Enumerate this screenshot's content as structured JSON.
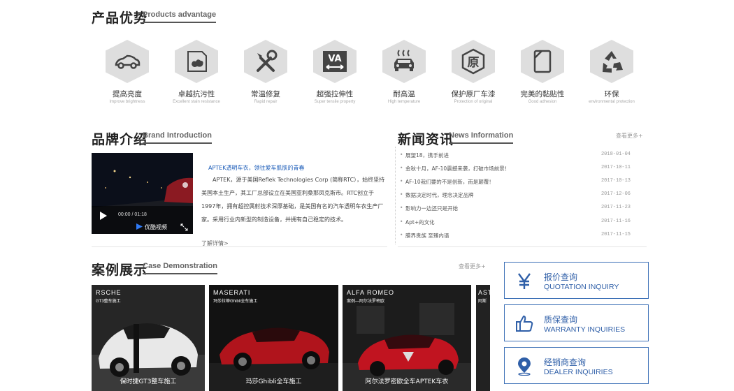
{
  "advantage": {
    "title": "产品优势",
    "subtitle": "Products advantage",
    "items": [
      {
        "label": "提高亮度",
        "en": "Improve brightness",
        "icon": "car-icon"
      },
      {
        "label": "卓越抗污性",
        "en": "Excellent stain resistance",
        "icon": "stain-icon"
      },
      {
        "label": "常温修复",
        "en": "Rapid repair",
        "icon": "tools-icon"
      },
      {
        "label": "超强拉伸性",
        "en": "Super tensile property",
        "icon": "va-stretch-icon"
      },
      {
        "label": "耐高温",
        "en": "High temperature",
        "icon": "hot-car-icon"
      },
      {
        "label": "保护原厂车漆",
        "en": "Protection of original",
        "icon": "original-seal-icon"
      },
      {
        "label": "完美的黏贴性",
        "en": "Good adhesion",
        "icon": "adhesion-icon"
      },
      {
        "label": "环保",
        "en": "environmental protection",
        "icon": "recycle-icon"
      }
    ]
  },
  "brand": {
    "title": "品牌介绍",
    "subtitle": "Brand Introduction",
    "headline": "APTEK透明车衣，领往爱车肌肤的青春",
    "body_lines": [
      "APTEK，源于美国Reflek Technologies Corp (简称RTC），始终坚持",
      "美国本土生产，其工厂总部设立在美国亚利桑那凤克斯市。RTC创立于",
      "1997年，拥有超控属射技术深厚基础，是美国有名的汽车透明车衣生产厂",
      "家。采用行业内新型的制造设备，并拥有自己稳定的技术。"
    ],
    "more": "了解详情>",
    "video": {
      "time": "00:00 / 01:18",
      "logo": "优酷视频"
    }
  },
  "news": {
    "title": "新闻资讯",
    "subtitle": "News Information",
    "more": "查看更多+",
    "items": [
      {
        "title": "展望18，携手前进",
        "date": "2018-01-04"
      },
      {
        "title": "金秋十月，AF-10震撼来袭，打破市场前景！",
        "date": "2017-10-11"
      },
      {
        "title": "AF-10我们要的不是创新，而是颠覆！",
        "date": "2017-10-13"
      },
      {
        "title": "数据决定时代，理念决定品牌",
        "date": "2017-12-06"
      },
      {
        "title": "影响力一边还只是开始",
        "date": "2017-11-23"
      },
      {
        "title": "Apt+的文化",
        "date": "2017-11-16"
      },
      {
        "title": "膜界贵族 至臻内语",
        "date": "2017-11-15"
      }
    ]
  },
  "cases": {
    "title": "案例展示",
    "subtitle": "Case Demonstration",
    "more": "查看更多+",
    "items": [
      {
        "brand": "RSCHE",
        "brand_sub": "GT3整车施工",
        "caption": "保时捷GT3整车施工"
      },
      {
        "brand": "MASERATI",
        "brand_sub": "玛莎拉蒂Ghibli全车施工",
        "caption": "玛莎Ghibli全车施工"
      },
      {
        "brand": "ALFA ROMEO",
        "brand_sub": "案例—阿尔法罗密欧",
        "caption": "阿尔法罗密欧全车APTEK车衣"
      },
      {
        "brand": "AST",
        "brand_sub": "阿斯",
        "caption": ""
      }
    ]
  },
  "inquiry": [
    {
      "zh": "报价查询",
      "en": "QUOTATION INQUIRY",
      "icon": "yen-icon"
    },
    {
      "zh": "质保查询",
      "en": "WARRANTY INQUIRIES",
      "icon": "thumbs-up-icon"
    },
    {
      "zh": "经销商查询",
      "en": "DEALER INQUIRIES",
      "icon": "location-pin-icon"
    }
  ],
  "colors": {
    "accent": "#2f5fa8",
    "hex_bg": "#dedede",
    "link": "#1a5bb8"
  }
}
